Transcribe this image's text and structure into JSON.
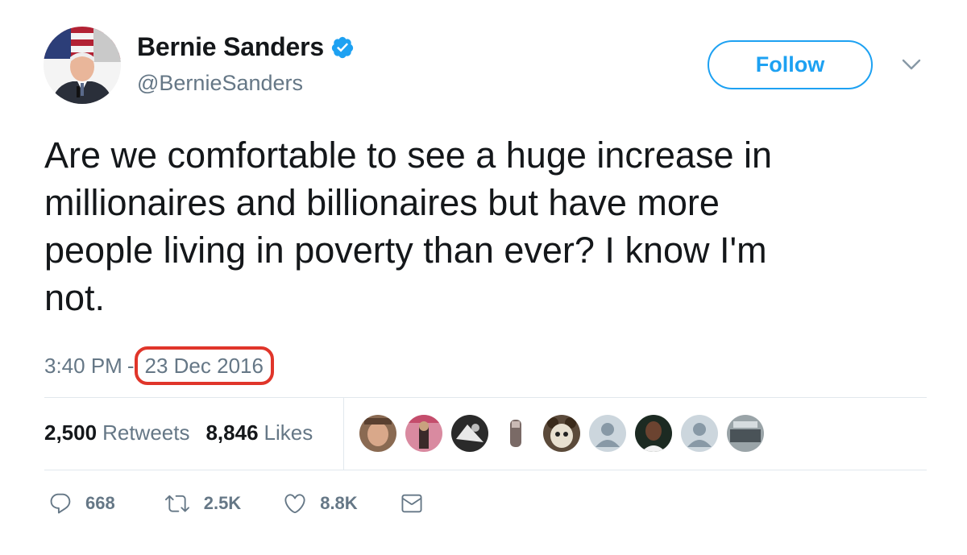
{
  "author": {
    "name": "Bernie Sanders",
    "handle": "@BernieSanders",
    "avatar_icon": "avatar-photo",
    "verified_icon": "verified-badge-icon"
  },
  "follow_button": {
    "label": "Follow"
  },
  "more_icon": "chevron-down-icon",
  "tweet": {
    "text": "Are we comfortable to see a huge increase in\nmillionaires and billionaires but have more\npeople living in poverty than ever? I know I'm\nnot.",
    "time": "3:40 PM",
    "separator": "-",
    "date": "23 Dec 2016"
  },
  "stats": {
    "retweets_count": "2,500",
    "retweets_label": "Retweets",
    "likes_count": "8,846",
    "likes_label": "Likes"
  },
  "likers": [
    {
      "name": "liker-avatar-1"
    },
    {
      "name": "liker-avatar-2"
    },
    {
      "name": "liker-avatar-3"
    },
    {
      "name": "liker-avatar-4"
    },
    {
      "name": "liker-avatar-5"
    },
    {
      "name": "liker-avatar-6"
    },
    {
      "name": "liker-avatar-7"
    },
    {
      "name": "liker-avatar-8"
    },
    {
      "name": "liker-avatar-9"
    }
  ],
  "actions": {
    "reply_count": "668",
    "retweet_count": "2.5K",
    "like_count": "8.8K"
  },
  "colors": {
    "accent": "#1da1f2",
    "text": "#14171a",
    "muted": "#657786",
    "highlight": "#e0352a",
    "divider": "#e1e8ed"
  }
}
